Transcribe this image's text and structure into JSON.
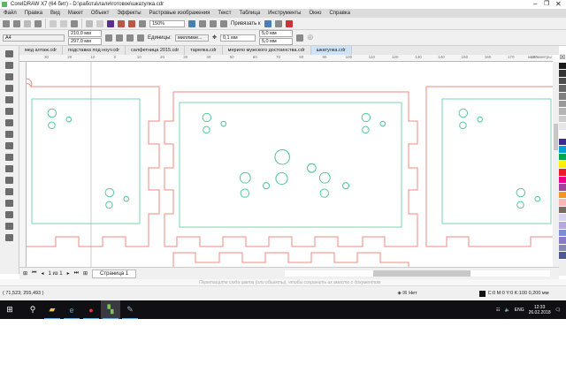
{
  "window": {
    "title": "CorelDRAW X7 (64 бит) - D:\\работа\\лали\\готовое\\шкатулка.cdr"
  },
  "menu": [
    "Файл",
    "Правка",
    "Вид",
    "Макет",
    "Объект",
    "Эффекты",
    "Растровые изображения",
    "Текст",
    "Таблица",
    "Инструменты",
    "Окно",
    "Справка"
  ],
  "toolbar": {
    "zoom": "150%",
    "snap": "Привязать к"
  },
  "property_bar": {
    "page_size": "A4",
    "width": "210,0 мм",
    "height": "297,0 мм",
    "units_label": "Единицы:",
    "units": "миллиме...",
    "nudge": "0,1 мм",
    "dup_x": "5,0 мм",
    "dup_y": "5,0 мм"
  },
  "doc_tabs": [
    "мед алтаж.cdr",
    "подставка под ноут.cdr",
    "салфетница 2015.cdr",
    "тарелка.cdr",
    "мерило мужского достоинства.cdr",
    "шкатулка.cdr"
  ],
  "active_tab": 5,
  "ruler": {
    "h_labels": [
      "30",
      "20",
      "10",
      "0",
      "10",
      "20",
      "30",
      "40",
      "50",
      "60",
      "70",
      "80",
      "90",
      "100",
      "110",
      "120",
      "130",
      "140",
      "150",
      "160",
      "170",
      "180"
    ],
    "units": "миллиметры"
  },
  "page_nav": {
    "count": "1 из 1",
    "page_tab": "Страница 1"
  },
  "doc_palette_hint": "Перетащите сюда цвета (или объекты), чтобы сохранить их вместе с документом",
  "status": {
    "coords": "( 71,523; 255,493 )",
    "fill": "Нет",
    "outline": "C:0 M:0 Y:0 K:100  0,200 мм"
  },
  "palette": [
    "#1a1a1a",
    "#333333",
    "#4d4d4d",
    "#666666",
    "#808080",
    "#999999",
    "#b3b3b3",
    "#cccccc",
    "#e6e6e6",
    "#ffffff",
    "#3a2d8f",
    "#0aa0d6",
    "#00a650",
    "#fff200",
    "#ed1c24",
    "#ec008c",
    "#a0449a",
    "#f7941d",
    "#f9b8b8",
    "#7b6a5f",
    "#d8d4f0",
    "#b3a9e0",
    "#7b8fd0",
    "#8a79c9",
    "#8a86b3",
    "#4d5c8a"
  ],
  "colors": {
    "cut_line": "#f08a80",
    "engrave": "#5cc99a"
  },
  "taskbar": {
    "apps": [
      "start-icon",
      "search-icon",
      "file-explorer-icon",
      "edge-icon",
      "yandex-browser-icon",
      "coreldraw-icon",
      "coreldraw-capture-icon"
    ],
    "lang": "ENG",
    "time": "12:33",
    "date": "26.02.2018"
  }
}
